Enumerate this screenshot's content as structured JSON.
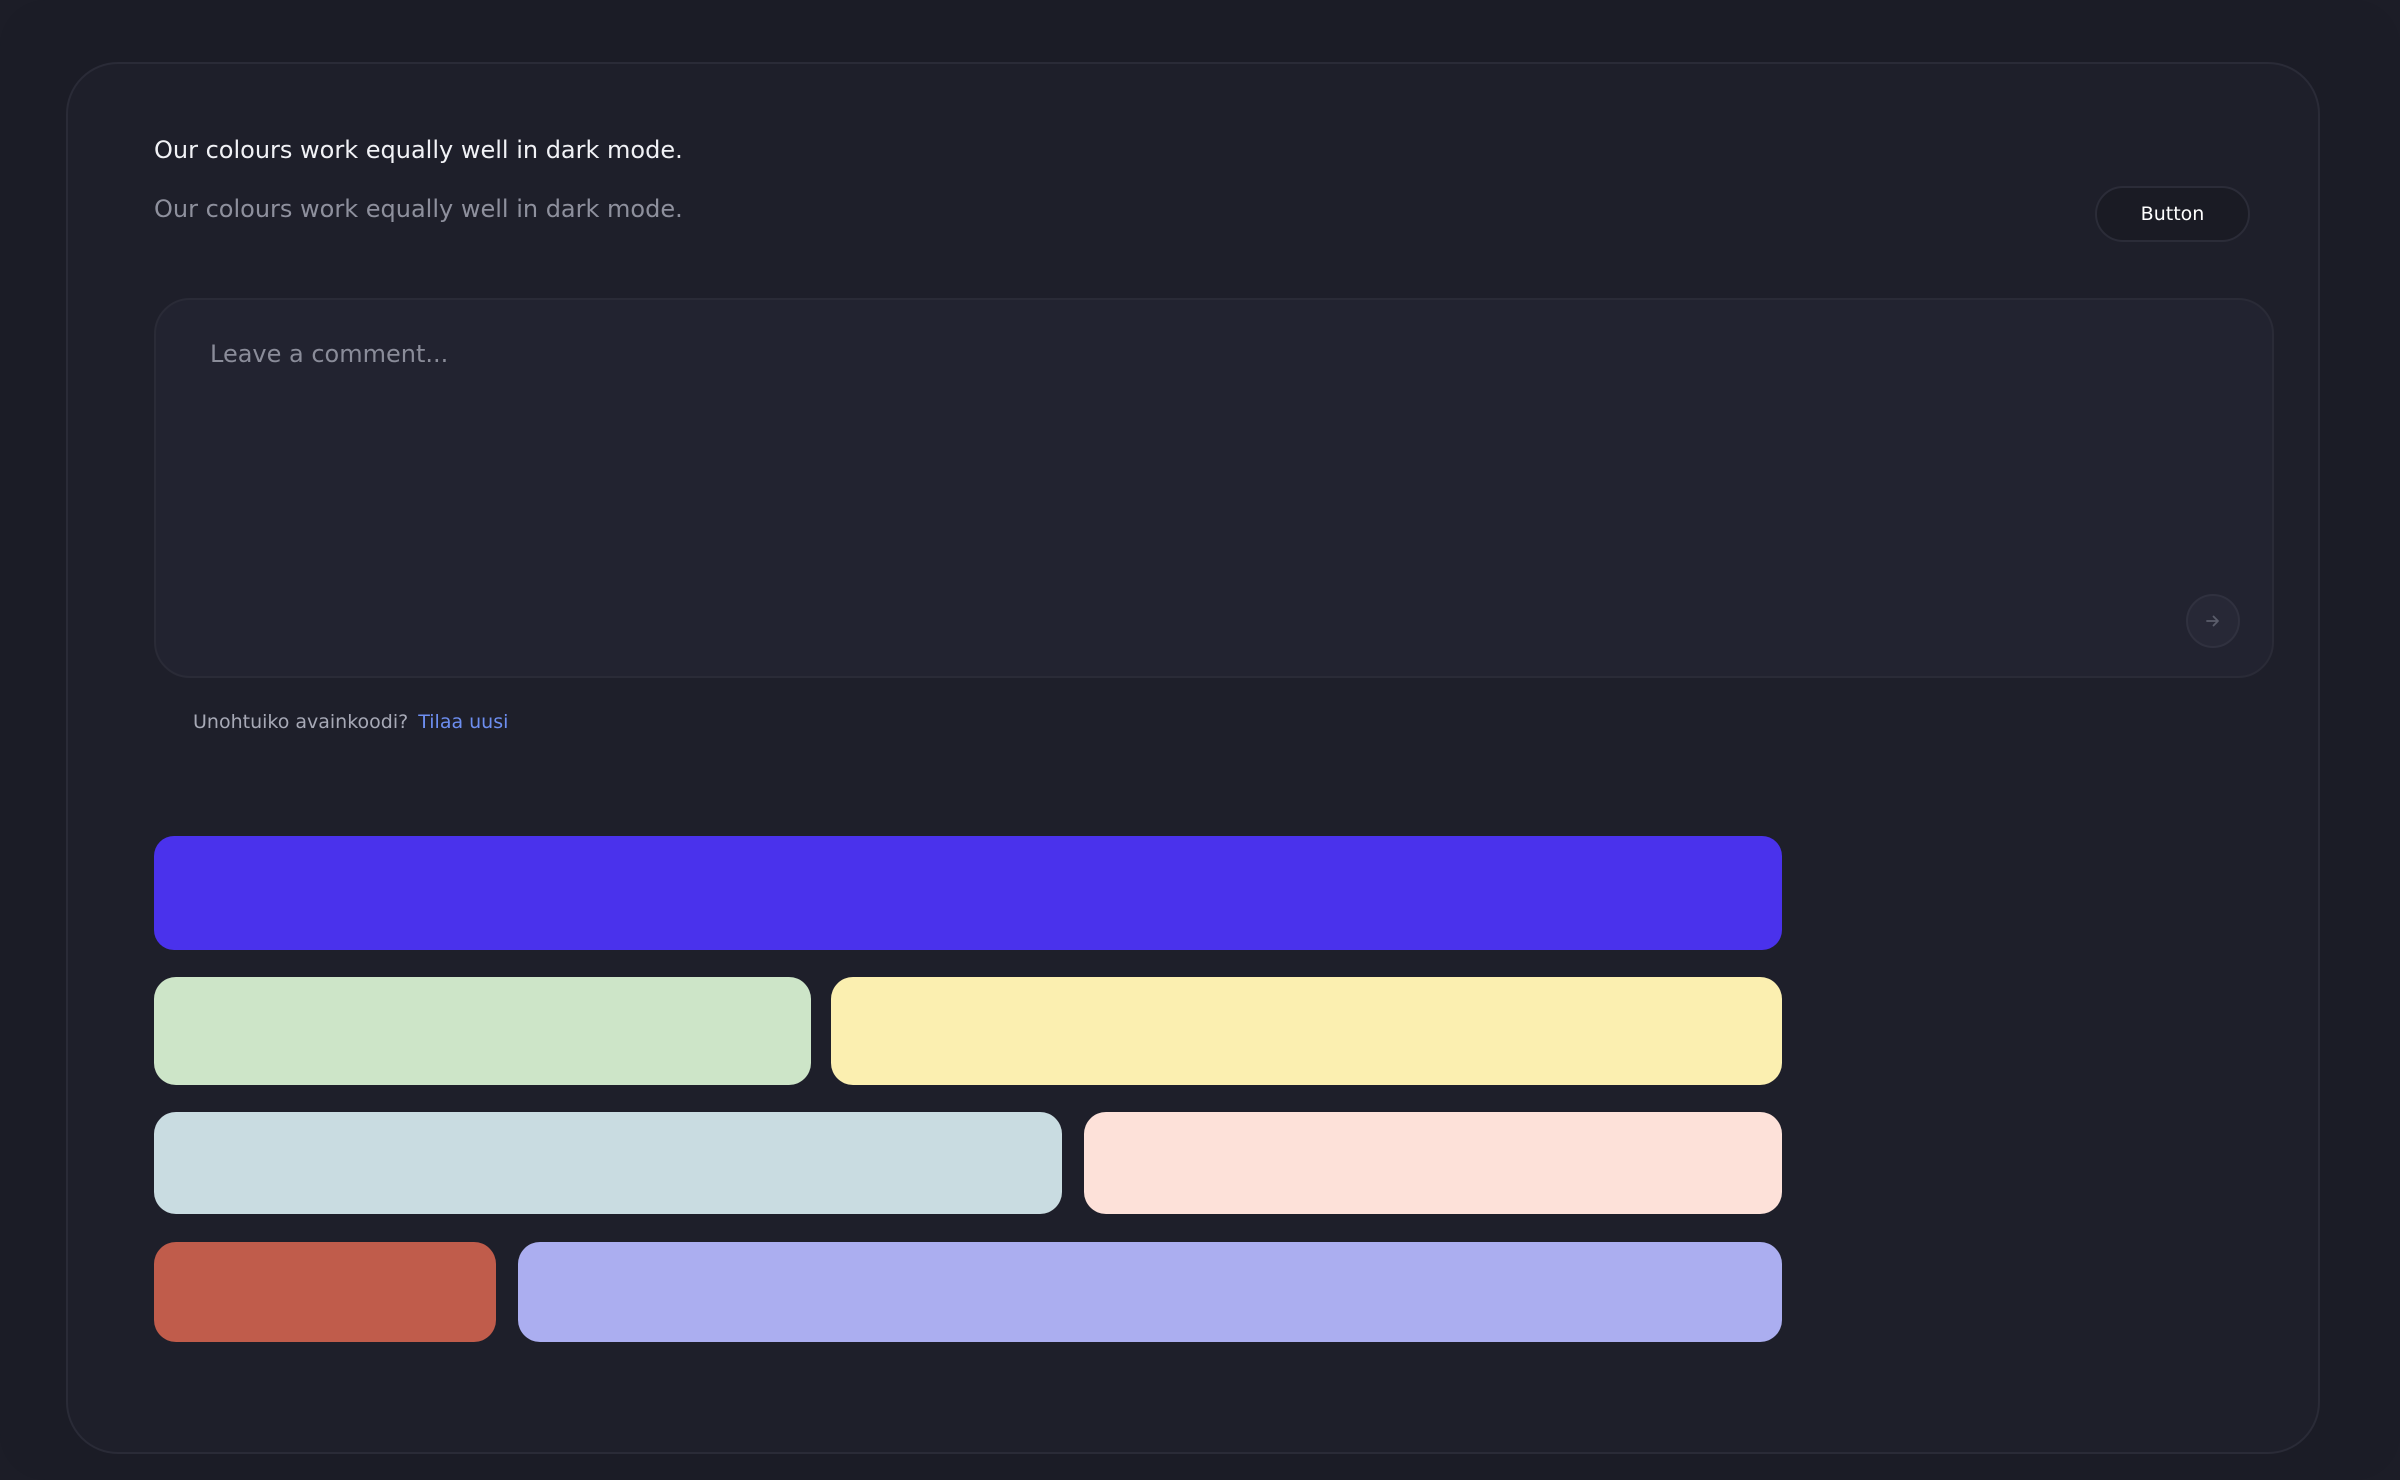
{
  "header": {
    "headline": "Our colours work equally well in dark mode.",
    "subline": "Our colours work equally well in dark mode.",
    "button_label": "Button"
  },
  "comment": {
    "placeholder": "Leave a comment...",
    "send_icon": "arrow-right-icon"
  },
  "forgot": {
    "text": "Unohtuiko avainkoodi?",
    "link": "Tilaa uusi"
  },
  "swatches": [
    {
      "name": "purple",
      "color": "#4a32ec"
    },
    {
      "name": "green",
      "color": "#cde5c8"
    },
    {
      "name": "yellow",
      "color": "#fbefb0"
    },
    {
      "name": "light-blue",
      "color": "#c9dce1"
    },
    {
      "name": "peach",
      "color": "#fde1d9"
    },
    {
      "name": "red",
      "color": "#c05c4b"
    },
    {
      "name": "lavender",
      "color": "#abaef0"
    }
  ]
}
